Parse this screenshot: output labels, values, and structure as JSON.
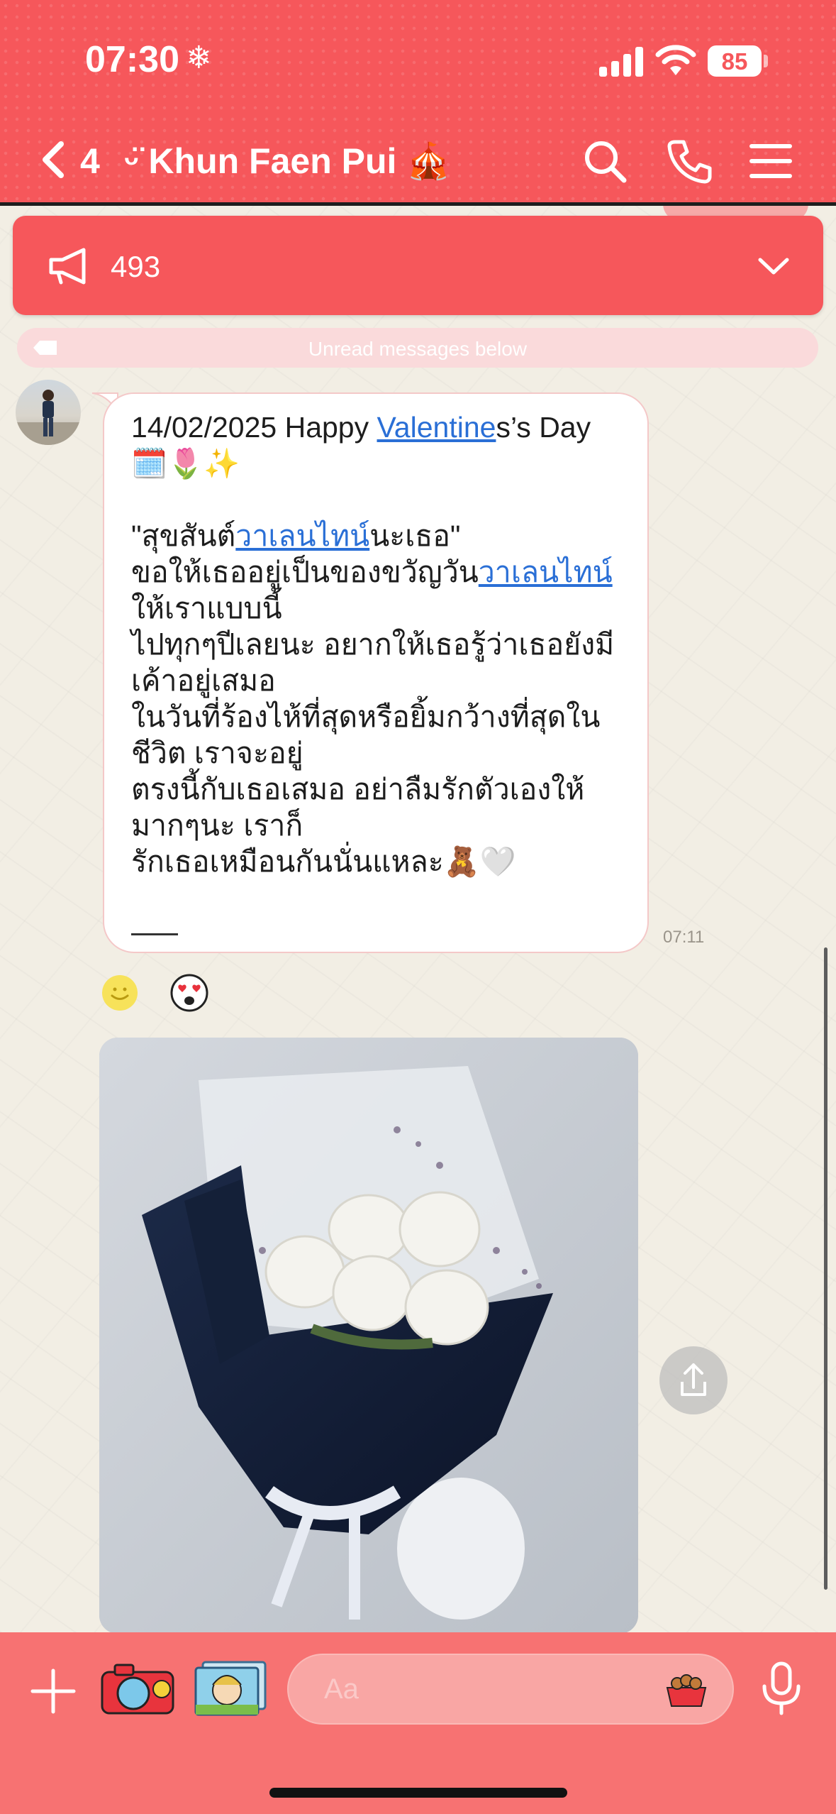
{
  "status_bar": {
    "time": "07:30",
    "weather_glyph": "❄",
    "battery": "85"
  },
  "header": {
    "back_count": "4",
    "title": "ᵕ̈ Khun Faen Pui 🎪",
    "icons": [
      "search-icon",
      "phone-icon",
      "menu-icon"
    ]
  },
  "announcement": {
    "count": "493"
  },
  "unread_divider": {
    "label": "Unread messages below"
  },
  "message": {
    "date_line_prefix": "14/02/2025 Happy ",
    "date_line_link": "Valentine",
    "date_line_suffix": "s’s Day",
    "emojis": "🗓️🌷✨",
    "quote_open": "\"สุขสันต์",
    "link_1": "วาเลนไทน์",
    "quote_close": "นะเธอ\"",
    "line_2_prefix": "ขอให้เธออยู่เป็นของขวัญวัน",
    "link_2": "วาเลนไทน์",
    "line_2_suffix": "ให้เราแบบนี้",
    "body_rest": "ไปทุกๆปีเลยนะ อยากให้เธอรู้ว่าเธอยังมีเค้าอยู่เสมอ\nในวันที่ร้องไห้ที่สุดหรือยิ้มกว้างที่สุดในชีวิต เราจะอยู่\nตรงนี้กับเธอเสมอ อย่าลืมรักตัวเองให้มากๆนะ เราก็\nรักเธอเหมือนกันนั่นแหละ🧸🤍",
    "time": "07:11"
  },
  "reactions": [
    "smile-icon",
    "heart-eyes-icon"
  ],
  "input": {
    "placeholder": "Aa"
  },
  "colors": {
    "brand_red": "#f6575b",
    "bottom_bar": "#f77272",
    "link_blue": "#2a6fd6"
  }
}
